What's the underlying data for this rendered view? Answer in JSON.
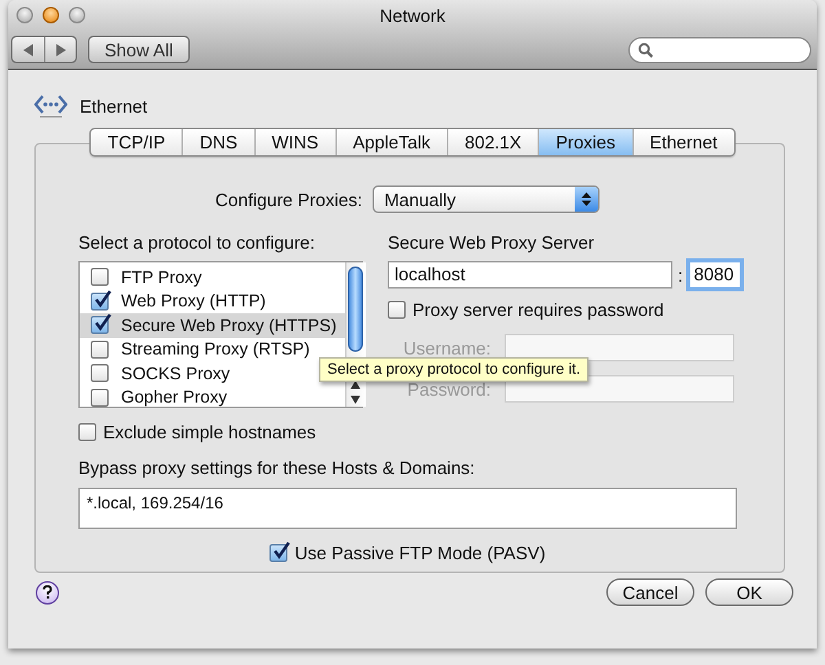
{
  "window": {
    "title": "Network"
  },
  "toolbar": {
    "show_all": "Show All"
  },
  "service": {
    "name": "Ethernet"
  },
  "tabs": [
    {
      "label": "TCP/IP",
      "selected": false
    },
    {
      "label": "DNS",
      "selected": false
    },
    {
      "label": "WINS",
      "selected": false
    },
    {
      "label": "AppleTalk",
      "selected": false
    },
    {
      "label": "802.1X",
      "selected": false
    },
    {
      "label": "Proxies",
      "selected": true
    },
    {
      "label": "Ethernet",
      "selected": false
    }
  ],
  "configure_proxies": {
    "label": "Configure Proxies:",
    "value": "Manually"
  },
  "protocols": {
    "label": "Select a protocol to configure:",
    "items": [
      {
        "label": "FTP Proxy",
        "checked": false,
        "selected": false
      },
      {
        "label": "Web Proxy (HTTP)",
        "checked": true,
        "selected": false
      },
      {
        "label": "Secure Web Proxy (HTTPS)",
        "checked": true,
        "selected": true
      },
      {
        "label": "Streaming Proxy (RTSP)",
        "checked": false,
        "selected": false
      },
      {
        "label": "SOCKS Proxy",
        "checked": false,
        "selected": false
      },
      {
        "label": "Gopher Proxy",
        "checked": false,
        "selected": false
      }
    ]
  },
  "server": {
    "label": "Secure Web Proxy Server",
    "host": "localhost",
    "separator": ":",
    "port": "8080",
    "requires_password": {
      "label": "Proxy server requires password",
      "checked": false
    },
    "username": {
      "label": "Username:",
      "disabled": true
    },
    "password": {
      "label": "Password:",
      "disabled": true
    }
  },
  "exclude_simple_hostnames": {
    "label": "Exclude simple hostnames",
    "checked": false
  },
  "bypass": {
    "label": "Bypass proxy settings for these Hosts & Domains:",
    "value": "*.local, 169.254/16"
  },
  "passive_ftp": {
    "label": "Use Passive FTP Mode (PASV)",
    "checked": true
  },
  "tooltip": "Select a proxy protocol to configure it.",
  "buttons": [
    {
      "label": "Cancel"
    },
    {
      "label": "OK"
    }
  ]
}
